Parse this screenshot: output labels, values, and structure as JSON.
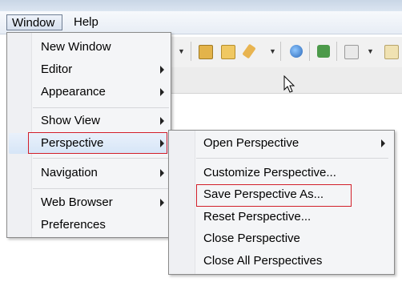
{
  "menubar": {
    "items": [
      {
        "label": "Window"
      },
      {
        "label": "Help"
      }
    ]
  },
  "window_menu": {
    "items": [
      {
        "label": "New Window",
        "submenu": false
      },
      {
        "label": "Editor",
        "submenu": true
      },
      {
        "label": "Appearance",
        "submenu": true
      },
      {
        "label": "Show View",
        "submenu": true
      },
      {
        "label": "Perspective",
        "submenu": true,
        "highlighted": true
      },
      {
        "label": "Navigation",
        "submenu": true
      },
      {
        "label": "Web Browser",
        "submenu": true
      },
      {
        "label": "Preferences",
        "submenu": false
      }
    ]
  },
  "perspective_submenu": {
    "items": [
      {
        "label": "Open Perspective",
        "submenu": true
      },
      {
        "label": "Customize Perspective..."
      },
      {
        "label": "Save Perspective As...",
        "highlighted": true
      },
      {
        "label": "Reset Perspective..."
      },
      {
        "label": "Close Perspective"
      },
      {
        "label": "Close All Perspectives"
      }
    ]
  },
  "toolbar": {
    "icons": [
      "open-folder-icon",
      "folder-icon",
      "pin-icon",
      "globe-icon",
      "run-icon",
      "page-icon",
      "help-icon"
    ]
  },
  "colors": {
    "highlight_border": "#d21f2a",
    "menu_background": "#f4f5f7"
  }
}
